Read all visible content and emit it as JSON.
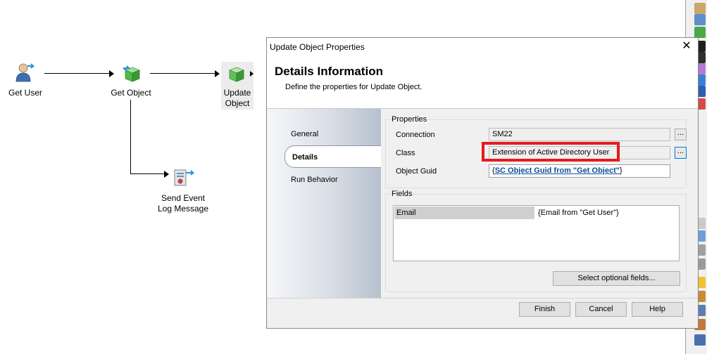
{
  "canvas": {
    "nodes": {
      "get_user": "Get User",
      "get_object": "Get Object",
      "update_object_line1": "Update",
      "update_object_line2": "Object",
      "send_event_line1": "Send Event",
      "send_event_line2": "Log Message"
    }
  },
  "dialog": {
    "title": "Update Object Properties",
    "close_glyph": "✕",
    "header_title": "Details Information",
    "header_subtitle": "Define the properties for Update Object.",
    "nav": {
      "general": "General",
      "details": "Details",
      "run_behavior": "Run Behavior"
    },
    "properties": {
      "group_label": "Properties",
      "connection_label": "Connection",
      "connection_value": "SM22",
      "class_label": "Class",
      "class_value": "Extension of Active Directory User",
      "object_guid_label": "Object Guid",
      "object_guid_open": "{",
      "object_guid_link": "SC Object Guid from \"Get Object\"",
      "object_guid_close": "}",
      "browse_glyph": "..."
    },
    "fields": {
      "group_label": "Fields",
      "rows": [
        {
          "name": "Email",
          "value": "{Email from \"Get User\"}"
        }
      ],
      "select_button": "Select optional fields..."
    },
    "footer": {
      "finish": "Finish",
      "cancel": "Cancel",
      "help": "Help"
    }
  },
  "colors": {
    "highlight_box": "#e8191c",
    "link": "#0a4e9a",
    "nav_gradient_end": "#b7c0ce"
  }
}
